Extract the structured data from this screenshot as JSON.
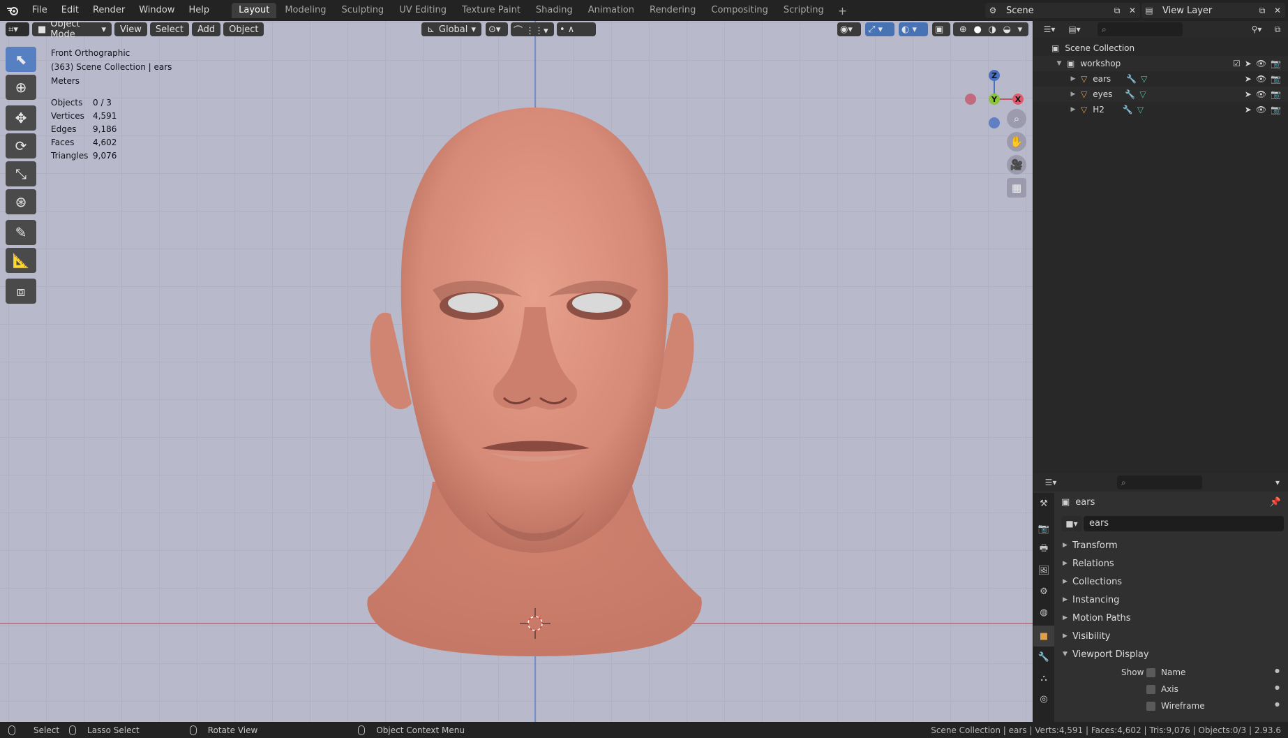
{
  "app": {
    "menu": [
      "File",
      "Edit",
      "Render",
      "Window",
      "Help"
    ],
    "workspaces": [
      "Layout",
      "Modeling",
      "Sculpting",
      "UV Editing",
      "Texture Paint",
      "Shading",
      "Animation",
      "Rendering",
      "Compositing",
      "Scripting"
    ],
    "active_workspace": "Layout",
    "scene": "Scene",
    "view_layer": "View Layer"
  },
  "viewport": {
    "mode": "Object Mode",
    "menu": [
      "View",
      "Select",
      "Add",
      "Object"
    ],
    "orientation": "Global",
    "view_name": "Front Orthographic",
    "collection_info": "(363) Scene Collection | ears",
    "units": "Meters",
    "stats": [
      {
        "label": "Objects",
        "value": "0 / 3"
      },
      {
        "label": "Vertices",
        "value": "4,591"
      },
      {
        "label": "Edges",
        "value": "9,186"
      },
      {
        "label": "Faces",
        "value": "4,602"
      },
      {
        "label": "Triangles",
        "value": "9,076"
      }
    ],
    "gizmo": {
      "z": "Z",
      "y": "Y",
      "x": "X"
    },
    "colors": {
      "background": "#b9b9cc",
      "skin": "#d98f7c",
      "x_axis": "#c8566a",
      "z_axis": "#4a72c0"
    }
  },
  "outliner": {
    "root": "Scene Collection",
    "collection": "workshop",
    "objects": [
      "ears",
      "eyes",
      "H2"
    ]
  },
  "properties": {
    "object_name": "ears",
    "object_field": "ears",
    "panels": [
      "Transform",
      "Relations",
      "Collections",
      "Instancing",
      "Motion Paths",
      "Visibility",
      "Viewport Display"
    ],
    "show_label": "Show",
    "show_options": [
      "Name",
      "Axis",
      "Wireframe"
    ]
  },
  "statusbar": {
    "select": "Select",
    "lasso": "Lasso Select",
    "rotate": "Rotate View",
    "context": "Object Context Menu",
    "info": "Scene Collection | ears | Verts:4,591 | Faces:4,602 | Tris:9,076 | Objects:0/3 | 2.93.6"
  }
}
